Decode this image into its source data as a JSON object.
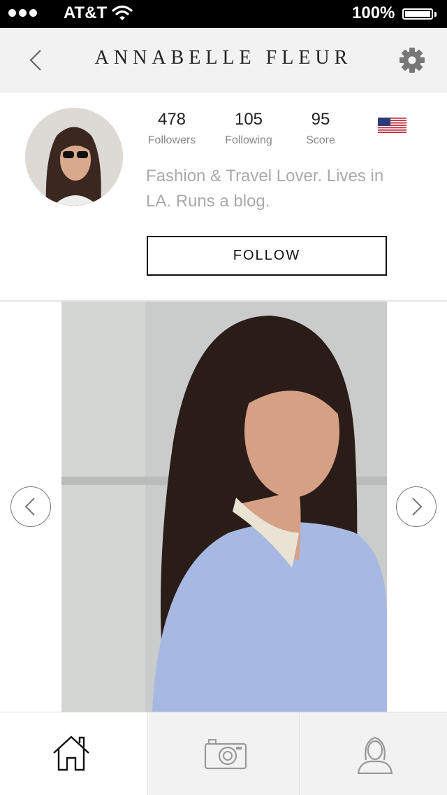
{
  "status_bar": {
    "carrier": "AT&T",
    "battery": "100%"
  },
  "nav": {
    "title": "ANNABELLE FLEUR"
  },
  "profile": {
    "followers_count": "478",
    "followers_label": "Followers",
    "following_count": "105",
    "following_label": "Following",
    "score_count": "95",
    "score_label": "Score",
    "bio": "Fashion & Travel Lover. Lives in LA. Runs a blog.",
    "follow_label": "FOLLOW"
  },
  "icons": {
    "back": "chevron-left-icon",
    "settings": "gear-icon",
    "flag": "us-flag-icon",
    "prev": "chevron-left-circle-icon",
    "next": "chevron-right-circle-icon",
    "home": "home-icon",
    "camera": "camera-icon",
    "profile": "person-icon"
  },
  "colors": {
    "nav_bg": "#f2f2f2",
    "bio_text": "#aaaaaa",
    "accent": "#111111"
  }
}
